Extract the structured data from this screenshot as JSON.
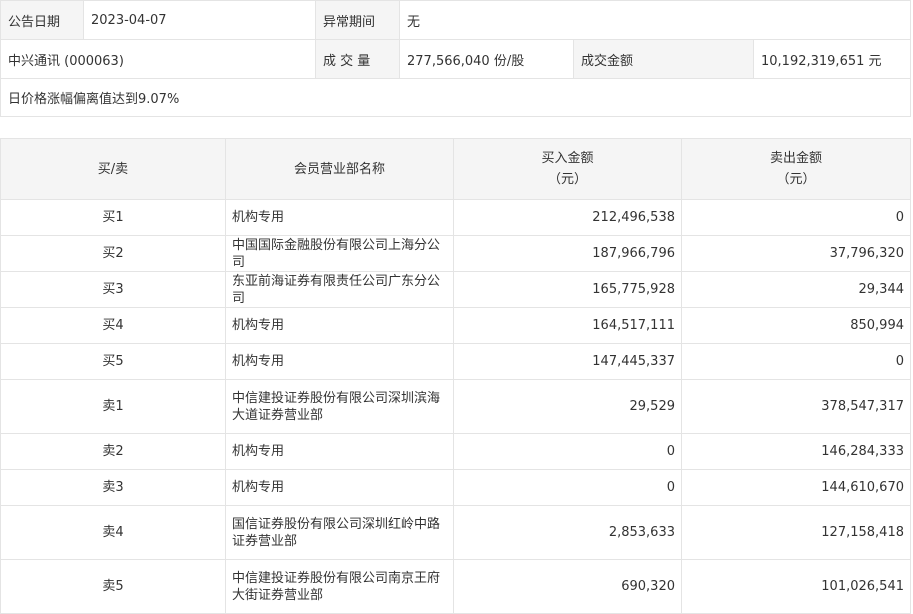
{
  "info": {
    "announce_date_label": "公告日期",
    "announce_date": "2023-04-07",
    "abnormal_period_label": "异常期间",
    "abnormal_period": "无",
    "stock": "中兴通讯 (000063)",
    "volume_label": "成 交 量",
    "volume": "277,566,040 份/股",
    "amount_label": "成交金额",
    "amount": "10,192,319,651 元",
    "reason": "日价格涨幅偏离值达到9.07%"
  },
  "table": {
    "headers": {
      "side": "买/卖",
      "member": "会员营业部名称",
      "buy_amount": "买入金额",
      "buy_unit": "（元）",
      "sell_amount": "卖出金额",
      "sell_unit": "（元）"
    },
    "rows": [
      {
        "side": "买1",
        "member": "机构专用",
        "buy": "212,496,538",
        "sell": "0"
      },
      {
        "side": "买2",
        "member": "中国国际金融股份有限公司上海分公司",
        "buy": "187,966,796",
        "sell": "37,796,320"
      },
      {
        "side": "买3",
        "member": "东亚前海证券有限责任公司广东分公司",
        "buy": "165,775,928",
        "sell": "29,344"
      },
      {
        "side": "买4",
        "member": "机构专用",
        "buy": "164,517,111",
        "sell": "850,994"
      },
      {
        "side": "买5",
        "member": "机构专用",
        "buy": "147,445,337",
        "sell": "0"
      },
      {
        "side": "卖1",
        "member": "中信建投证券股份有限公司深圳滨海大道证券营业部",
        "buy": "29,529",
        "sell": "378,547,317"
      },
      {
        "side": "卖2",
        "member": "机构专用",
        "buy": "0",
        "sell": "146,284,333"
      },
      {
        "side": "卖3",
        "member": "机构专用",
        "buy": "0",
        "sell": "144,610,670"
      },
      {
        "side": "卖4",
        "member": "国信证券股份有限公司深圳红岭中路证券营业部",
        "buy": "2,853,633",
        "sell": "127,158,418"
      },
      {
        "side": "卖5",
        "member": "中信建投证券股份有限公司南京王府大街证券营业部",
        "buy": "690,320",
        "sell": "101,026,541"
      }
    ]
  }
}
